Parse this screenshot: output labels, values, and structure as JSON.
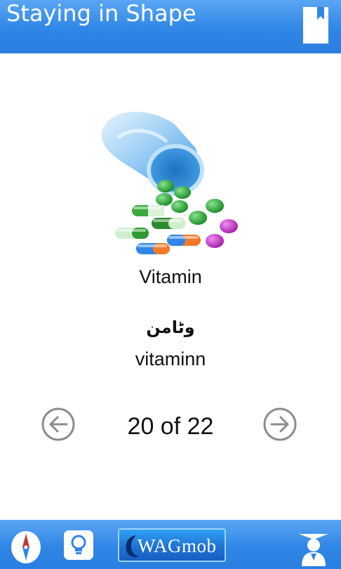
{
  "header": {
    "title": "Staying in Shape",
    "bookmark_icon": "bookmark-icon"
  },
  "card": {
    "image_icon": "vitamin-pills-illustration",
    "word_english": "Vitamin",
    "word_arabic": "وٹامن",
    "word_transliteration": "vitaminn"
  },
  "pager": {
    "prev_icon": "arrow-left-circle-icon",
    "counter": "20 of 22",
    "next_icon": "arrow-right-circle-icon"
  },
  "footer": {
    "compass_icon": "compass-icon",
    "tip_icon": "lightbulb-icon",
    "brand_label": "WAGmob",
    "expert_icon": "teacher-icon"
  },
  "colors": {
    "bar_blue": "#2f86e6",
    "text": "#111111",
    "nav_circle": "#8c8c8c"
  }
}
